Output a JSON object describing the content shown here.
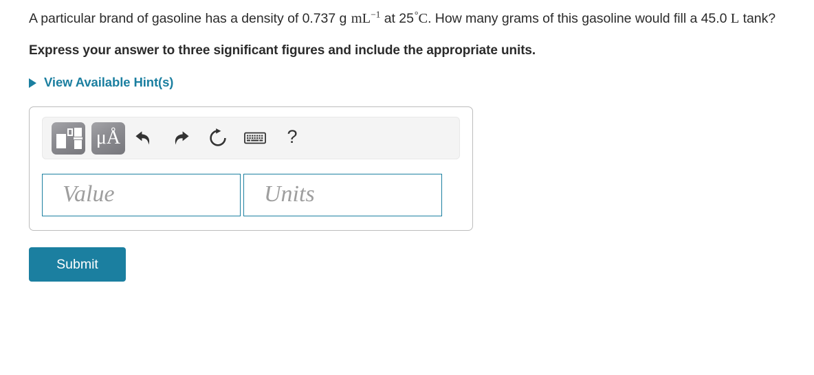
{
  "question": {
    "part1": "A particular brand of gasoline has a density of 0.737 g",
    "unit_density": "mL",
    "unit_exponent": "−1",
    "part2": "at 25",
    "degree": "°",
    "unit_temp": "C",
    "part3": ". How many grams of this gasoline would fill a 45.0",
    "unit_volume": "L",
    "part4": "tank?"
  },
  "instruction": "Express your answer to three significant figures and include the appropriate units.",
  "hints": {
    "label": "View Available Hint(s)",
    "icon": "triangle-right-icon",
    "color": "#1b7fa0"
  },
  "toolbar": {
    "buttons": [
      {
        "name": "template-button",
        "icon": "math-template-icon",
        "label": ""
      },
      {
        "name": "units-button",
        "icon": "micro-angstrom-icon",
        "label": "μÅ"
      },
      {
        "name": "undo-button",
        "icon": "undo-arrow-icon",
        "label": ""
      },
      {
        "name": "redo-button",
        "icon": "redo-arrow-icon",
        "label": ""
      },
      {
        "name": "reset-button",
        "icon": "reset-circular-arrow-icon",
        "label": ""
      },
      {
        "name": "keyboard-button",
        "icon": "keyboard-icon",
        "label": ""
      },
      {
        "name": "help-button",
        "icon": "question-mark-icon",
        "label": "?"
      }
    ]
  },
  "inputs": {
    "value_placeholder": "Value",
    "value_text": "",
    "units_placeholder": "Units",
    "units_text": ""
  },
  "submit": {
    "label": "Submit",
    "color": "#1b7fa0"
  }
}
